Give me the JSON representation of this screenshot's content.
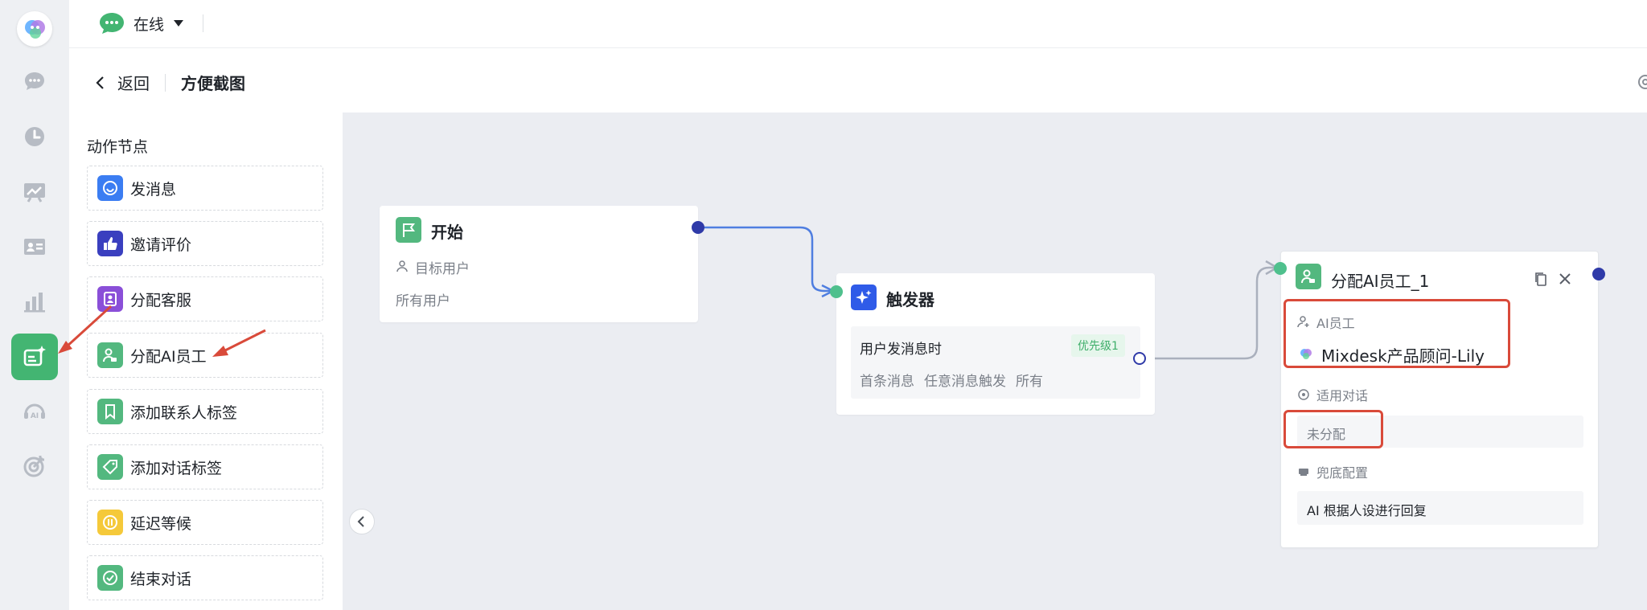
{
  "topbar": {
    "status_label": "在线"
  },
  "header": {
    "back_label": "返回",
    "page_title": "方便截图"
  },
  "actions": {
    "heading": "动作节点",
    "items": [
      {
        "label": "发消息",
        "color": "#3b7df2",
        "icon": "message-icon"
      },
      {
        "label": "邀请评价",
        "color": "#3a3fbf",
        "icon": "thumbs-up-icon"
      },
      {
        "label": "分配客服",
        "color": "#8a4fd8",
        "icon": "agent-badge-icon"
      },
      {
        "label": "分配AI员工",
        "color": "#53b87f",
        "icon": "ai-agent-icon"
      },
      {
        "label": "添加联系人标签",
        "color": "#53b87f",
        "icon": "bookmark-icon"
      },
      {
        "label": "添加对话标签",
        "color": "#53b87f",
        "icon": "tag-icon"
      },
      {
        "label": "延迟等候",
        "color": "#f5c93a",
        "icon": "pause-icon"
      },
      {
        "label": "结束对话",
        "color": "#53b87f",
        "icon": "check-circle-icon"
      }
    ]
  },
  "start_node": {
    "title": "开始",
    "field_label": "目标用户",
    "field_value": "所有用户"
  },
  "trigger_node": {
    "title": "触发器",
    "event": "用户发消息时",
    "priority": "优先级1",
    "tags": [
      "首条消息",
      "任意消息触发",
      "所有"
    ]
  },
  "assign_node": {
    "title": "分配AI员工_1",
    "ai_label": "AI员工",
    "ai_value": "Mixdesk产品顾问-Lily",
    "conv_label": "适用对话",
    "conv_value": "未分配",
    "fallback_label": "兜底配置",
    "fallback_value": "AI 根据人设进行回复"
  },
  "colors": {
    "accent_green": "#43b572",
    "annotation_red": "#d94a3a",
    "link_blue": "#2f3aa8"
  }
}
